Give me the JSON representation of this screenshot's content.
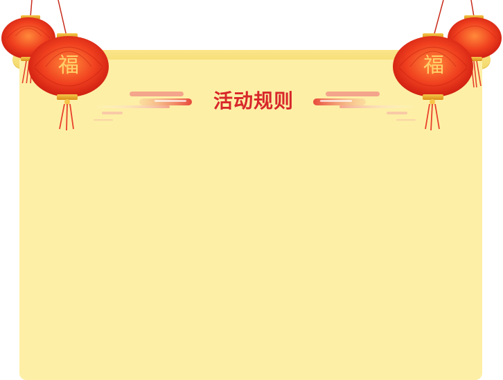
{
  "header": {
    "title": "活动规则"
  },
  "lanterns": {
    "character": "福"
  },
  "colors": {
    "panel": "#fdefa6",
    "rod": "#f5dc74",
    "title": "#d8262a",
    "lantern_red": "#e8301f",
    "lantern_gold": "#f6c64a"
  }
}
